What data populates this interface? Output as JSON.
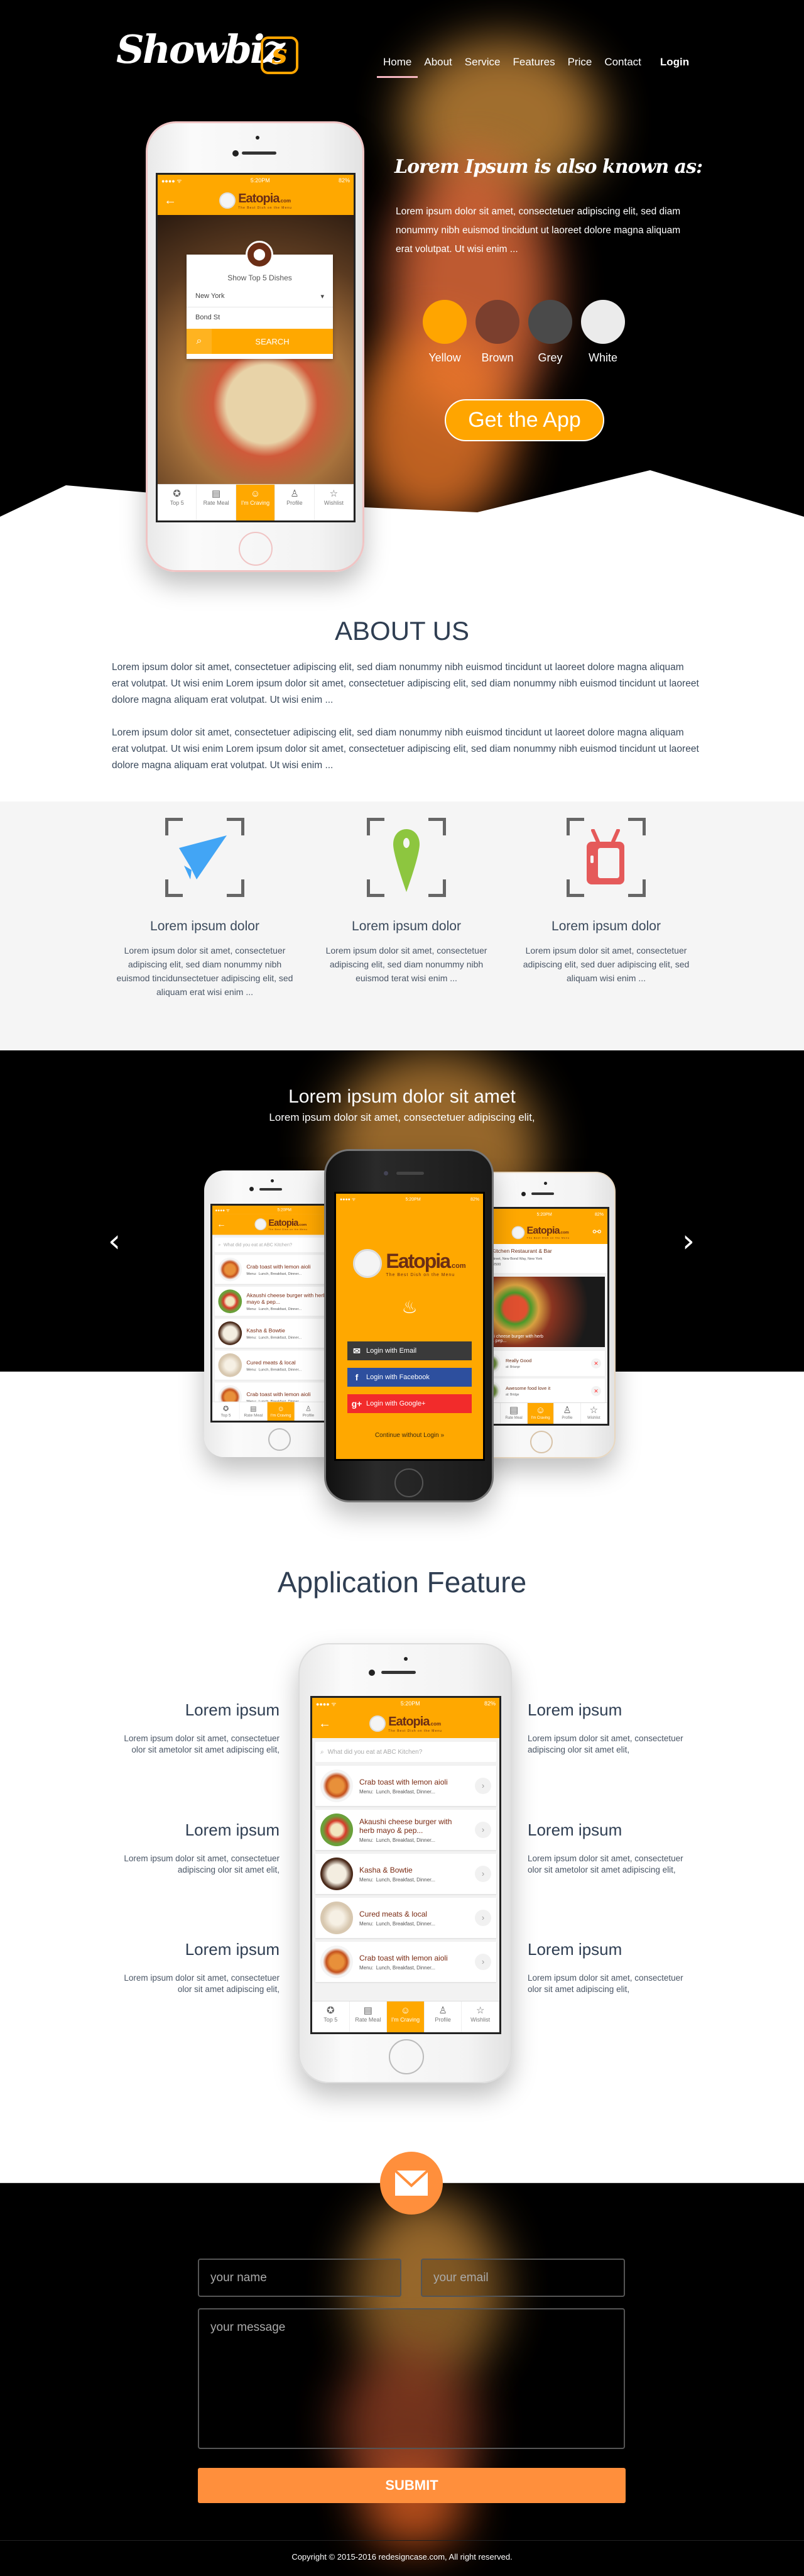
{
  "nav": {
    "logo": "Showbiz",
    "logo_badge": "s",
    "items": [
      "Home",
      "About",
      "Service",
      "Features",
      "Price",
      "Contact"
    ],
    "active": "Home",
    "login": "Login"
  },
  "hero": {
    "heading": "Lorem Ipsum is also known as:",
    "paragraph": "Lorem ipsum dolor sit amet, consectetuer adipiscing elit, sed diam nonummy nibh euismod tincidunt ut laoreet dolore magna aliquam erat volutpat. Ut wisi enim ...",
    "colors": [
      {
        "name": "Yellow",
        "hex": "#FFA500"
      },
      {
        "name": "Brown",
        "hex": "#7B3F2E"
      },
      {
        "name": "Grey",
        "hex": "#4A4A4A"
      },
      {
        "name": "White",
        "hex": "#EBEBEB"
      }
    ],
    "cta": "Get the App"
  },
  "app": {
    "time": "5:20PM",
    "battery": "82%",
    "brand": "Eatopia",
    "brand_suffix": ".com",
    "tagline": "The Best Dish on the Menu",
    "tabs": [
      "Top 5",
      "Rate Meal",
      "I'm Craving",
      "Profile",
      "Wishlist"
    ],
    "active_tab": "I'm Craving",
    "accent": "#FFA800"
  },
  "hero_phone": {
    "card_title": "Show Top 5 Dishes",
    "city": "New York",
    "street": "Bond St",
    "search": "SEARCH"
  },
  "about": {
    "title": "ABOUT US",
    "paragraphs": [
      "Lorem ipsum dolor sit amet, consectetuer adipiscing elit, sed diam nonummy nibh euismod tincidunt ut laoreet dolore magna aliquam erat volutpat. Ut wisi enim Lorem ipsum dolor sit amet, consectetuer adipiscing elit, sed diam nonummy nibh euismod tincidunt ut laoreet dolore magna aliquam erat volutpat. Ut wisi enim ...",
      "Lorem ipsum dolor sit amet, consectetuer adipiscing elit, sed diam nonummy nibh euismod tincidunt ut laoreet dolore magna aliquam erat volutpat. Ut wisi enim Lorem ipsum dolor sit amet, consectetuer adipiscing elit, sed diam nonummy nibh euismod tincidunt ut laoreet dolore magna aliquam erat volutpat. Ut wisi enim ..."
    ]
  },
  "services": [
    {
      "icon": "paper-plane-icon",
      "color": "#42A5F5",
      "title": "Lorem ipsum dolor",
      "desc": "Lorem ipsum dolor sit amet, consectetuer adipiscing elit, sed diam nonummy nibh euismod tincidunsectetuer adipiscing elit, sed aliquam erat wisi enim ..."
    },
    {
      "icon": "map-pin-icon",
      "color": "#8DC63F",
      "title": "Lorem ipsum dolor",
      "desc": "Lorem ipsum dolor sit amet, consectetuer adipiscing elit, sed diam nonummy nibh euismod terat wisi enim ..."
    },
    {
      "icon": "tv-icon",
      "color": "#E55A5A",
      "title": "Lorem ipsum dolor",
      "desc": "Lorem ipsum dolor sit amet, consectetuer adipiscing elit, sed duer adipiscing elit, sed aliquam wisi enim ..."
    }
  ],
  "slider": {
    "title": "Lorem ipsum dolor sit amet",
    "subtitle": "Lorem ipsum dolor sit amet, consectetuer adipiscing elit,",
    "login_email": "Login with Email",
    "login_facebook": "Login with Facebook",
    "login_google": "Login with Google+",
    "continue": "Continue without Login »",
    "restaurant": {
      "name": "ABC Kitchen Restaurant & Bar",
      "address": "6 Bond Street, New Bond Way, New York",
      "phone": "212-777-2500",
      "dish": "Akaushi cheese burger with herb mayo & pep...",
      "reviews": [
        {
          "text": "Really Good",
          "by": "at: Brianpr"
        },
        {
          "text": "Awesome food love it",
          "by": "at: Bridge"
        }
      ]
    }
  },
  "feature": {
    "title": "Application Feature",
    "search_placeholder": "What did you eat at ABC Kitchen?",
    "menu_label": "Menu:",
    "menu_value": "Lunch, Breakfast, Dinner...",
    "list_items": [
      {
        "name": "Crab toast with lemon aioli"
      },
      {
        "name": "Akaushi cheese burger with herb mayo & pep..."
      },
      {
        "name": "Kasha & Bowtie"
      },
      {
        "name": "Cured meats & local"
      },
      {
        "name": "Crab toast with lemon aioli"
      }
    ],
    "left": [
      {
        "title": "Lorem ipsum",
        "lines": [
          "Lorem ipsum dolor sit amet, consectetuer",
          "olor sit ametolor sit amet adipiscing elit,"
        ]
      },
      {
        "title": "Lorem ipsum",
        "lines": [
          "Lorem ipsum dolor sit amet, consectetuer",
          "adipiscing  olor sit amet elit,"
        ]
      },
      {
        "title": "Lorem ipsum",
        "lines": [
          "Lorem ipsum dolor sit amet, consectetuer",
          "olor sit amet adipiscing elit,"
        ]
      }
    ],
    "right": [
      {
        "title": "Lorem ipsum",
        "lines": [
          "Lorem ipsum dolor sit amet, consectetuer",
          "adipiscing  olor sit amet elit,"
        ]
      },
      {
        "title": "Lorem ipsum",
        "lines": [
          "Lorem ipsum dolor sit amet, consectetuer",
          "olor sit ametolor sit amet adipiscing elit,"
        ]
      },
      {
        "title": "Lorem ipsum",
        "lines": [
          "Lorem ipsum dolor sit amet, consectetuer",
          "olor sit amet adipiscing elit,"
        ]
      }
    ]
  },
  "contact": {
    "name_placeholder": "your name",
    "email_placeholder": "your email",
    "message_placeholder": "your message",
    "submit": "SUBMIT",
    "copyright": "Copyright © 2015-2016 redesigncase.com, All right reserved.",
    "accent": "#FF8F3C"
  }
}
